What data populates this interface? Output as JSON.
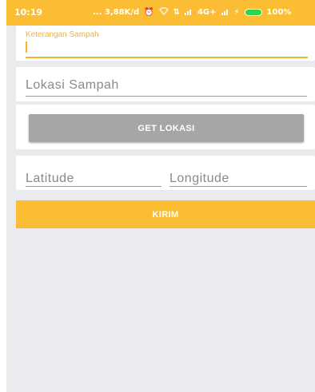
{
  "status_bar": {
    "time": "10:19",
    "network_speed": "... 3,88K/d",
    "network_type": "4G+",
    "battery_percent": "100%",
    "color": "#fbbd34"
  },
  "form": {
    "keterangan": {
      "label": "Keterangan Sampah",
      "value": ""
    },
    "lokasi": {
      "placeholder": "Lokasi Sampah",
      "value": ""
    },
    "get_lokasi_label": "GET LOKASI",
    "latitude": {
      "placeholder": "Latitude",
      "value": ""
    },
    "longitude": {
      "placeholder": "Longitude",
      "value": ""
    },
    "kirim_label": "KIRIM"
  },
  "colors": {
    "accent": "#fbbd34",
    "background": "#e9ebee",
    "button_disabled": "#a6a6a6"
  }
}
